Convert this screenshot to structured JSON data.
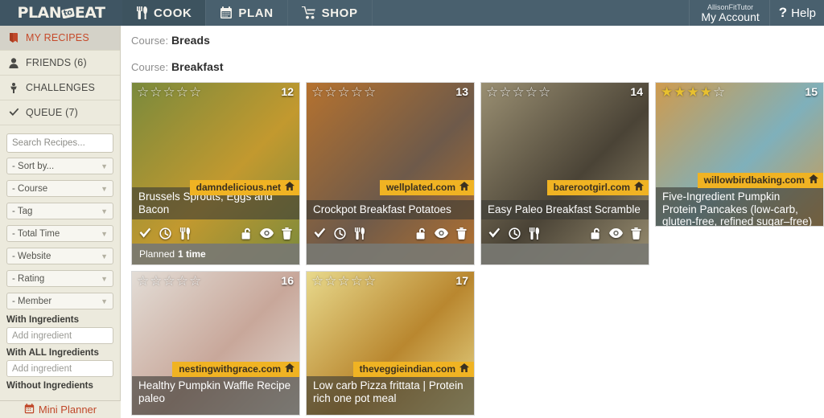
{
  "nav": {
    "logo": {
      "text_a": "PLAN",
      "to": "to",
      "text_b": "EAT"
    },
    "tabs": [
      {
        "label": "COOK",
        "icon": "fork-knife-icon",
        "active": true
      },
      {
        "label": "PLAN",
        "icon": "calendar-icon",
        "active": false
      },
      {
        "label": "SHOP",
        "icon": "cart-icon",
        "active": false
      }
    ],
    "account": {
      "username": "AllisonFitTutor",
      "label": "My Account"
    },
    "help": {
      "label": "Help",
      "glyph": "?"
    }
  },
  "sidebar": {
    "items": [
      {
        "label": "MY RECIPES",
        "icon": "book-icon",
        "active": true
      },
      {
        "label": "FRIENDS (6)",
        "icon": "person-icon",
        "active": false
      },
      {
        "label": "CHALLENGES",
        "icon": "trophy-icon",
        "active": false
      },
      {
        "label": "QUEUE (7)",
        "icon": "check-icon",
        "active": false
      }
    ],
    "search": {
      "placeholder": "Search Recipes...",
      "value": "",
      "icon": "search-icon"
    },
    "filters": [
      {
        "label": "- Sort by..."
      },
      {
        "label": "- Course"
      },
      {
        "label": "- Tag"
      },
      {
        "label": "- Total Time"
      },
      {
        "label": "- Website"
      },
      {
        "label": "- Rating"
      },
      {
        "label": "- Member"
      }
    ],
    "ingredients": [
      {
        "label": "With Ingredients",
        "placeholder": "Add ingredient",
        "value": ""
      },
      {
        "label": "With ALL Ingredients",
        "placeholder": "Add ingredient",
        "value": ""
      },
      {
        "label": "Without Ingredients",
        "placeholder": "Add ingredient",
        "value": ""
      }
    ],
    "mini_planner": {
      "label": "Mini Planner",
      "icon": "calendar-icon"
    }
  },
  "main": {
    "sections": [
      {
        "prefix": "Course:",
        "name": "Breads"
      },
      {
        "prefix": "Course:",
        "name": "Breakfast"
      }
    ],
    "recipes": [
      {
        "number": "12",
        "title": "Brussels Sprouts, Eggs and Bacon",
        "site": "damndelicious.net",
        "rating": 0,
        "planned": "Planned",
        "planned_count": "1 time",
        "photo_a": "#7a8a3c",
        "photo_b": "#c2992f"
      },
      {
        "number": "13",
        "title": "Crockpot Breakfast Potatoes",
        "site": "wellplated.com",
        "rating": 0,
        "planned": "",
        "planned_count": "",
        "photo_a": "#b5722f",
        "photo_b": "#6e5a4a"
      },
      {
        "number": "14",
        "title": "Easy Paleo Breakfast Scramble",
        "site": "barerootgirl.com",
        "rating": 0,
        "planned": "",
        "planned_count": "",
        "photo_a": "#9a8f72",
        "photo_b": "#4a4336"
      },
      {
        "number": "15",
        "title": "Five-Ingredient Pumpkin Protein Pancakes (low-carb, gluten-free, refined sugar–free)",
        "site": "willowbirdbaking.com",
        "rating": 4,
        "planned": "",
        "planned_count": "",
        "photo_a": "#cf9b4e",
        "photo_b": "#7fb0bb"
      },
      {
        "number": "16",
        "title": "Healthy Pumpkin Waffle Recipe paleo",
        "site": "nestingwithgrace.com",
        "rating": 0,
        "planned": "",
        "planned_count": "",
        "photo_a": "#e3ddd6",
        "photo_b": "#c8a79a"
      },
      {
        "number": "17",
        "title": "Low carb Pizza frittata | Protein rich one pot meal",
        "site": "theveggieindian.com",
        "rating": 0,
        "planned": "",
        "planned_count": "",
        "photo_a": "#e8d98c",
        "photo_b": "#b9872f"
      }
    ],
    "card_icons_left": [
      "check-icon",
      "clock-icon",
      "fork-knife-icon"
    ],
    "card_icons_right": [
      "unlock-icon",
      "eye-icon",
      "trash-icon"
    ]
  },
  "colors": {
    "nav_bg": "#49606e",
    "nav_active": "#3d535f",
    "sidebar_bg": "#eceadd",
    "accent_red": "#c0482a",
    "site_badge": "#f0b323",
    "star_gold": "#e8c02f"
  }
}
